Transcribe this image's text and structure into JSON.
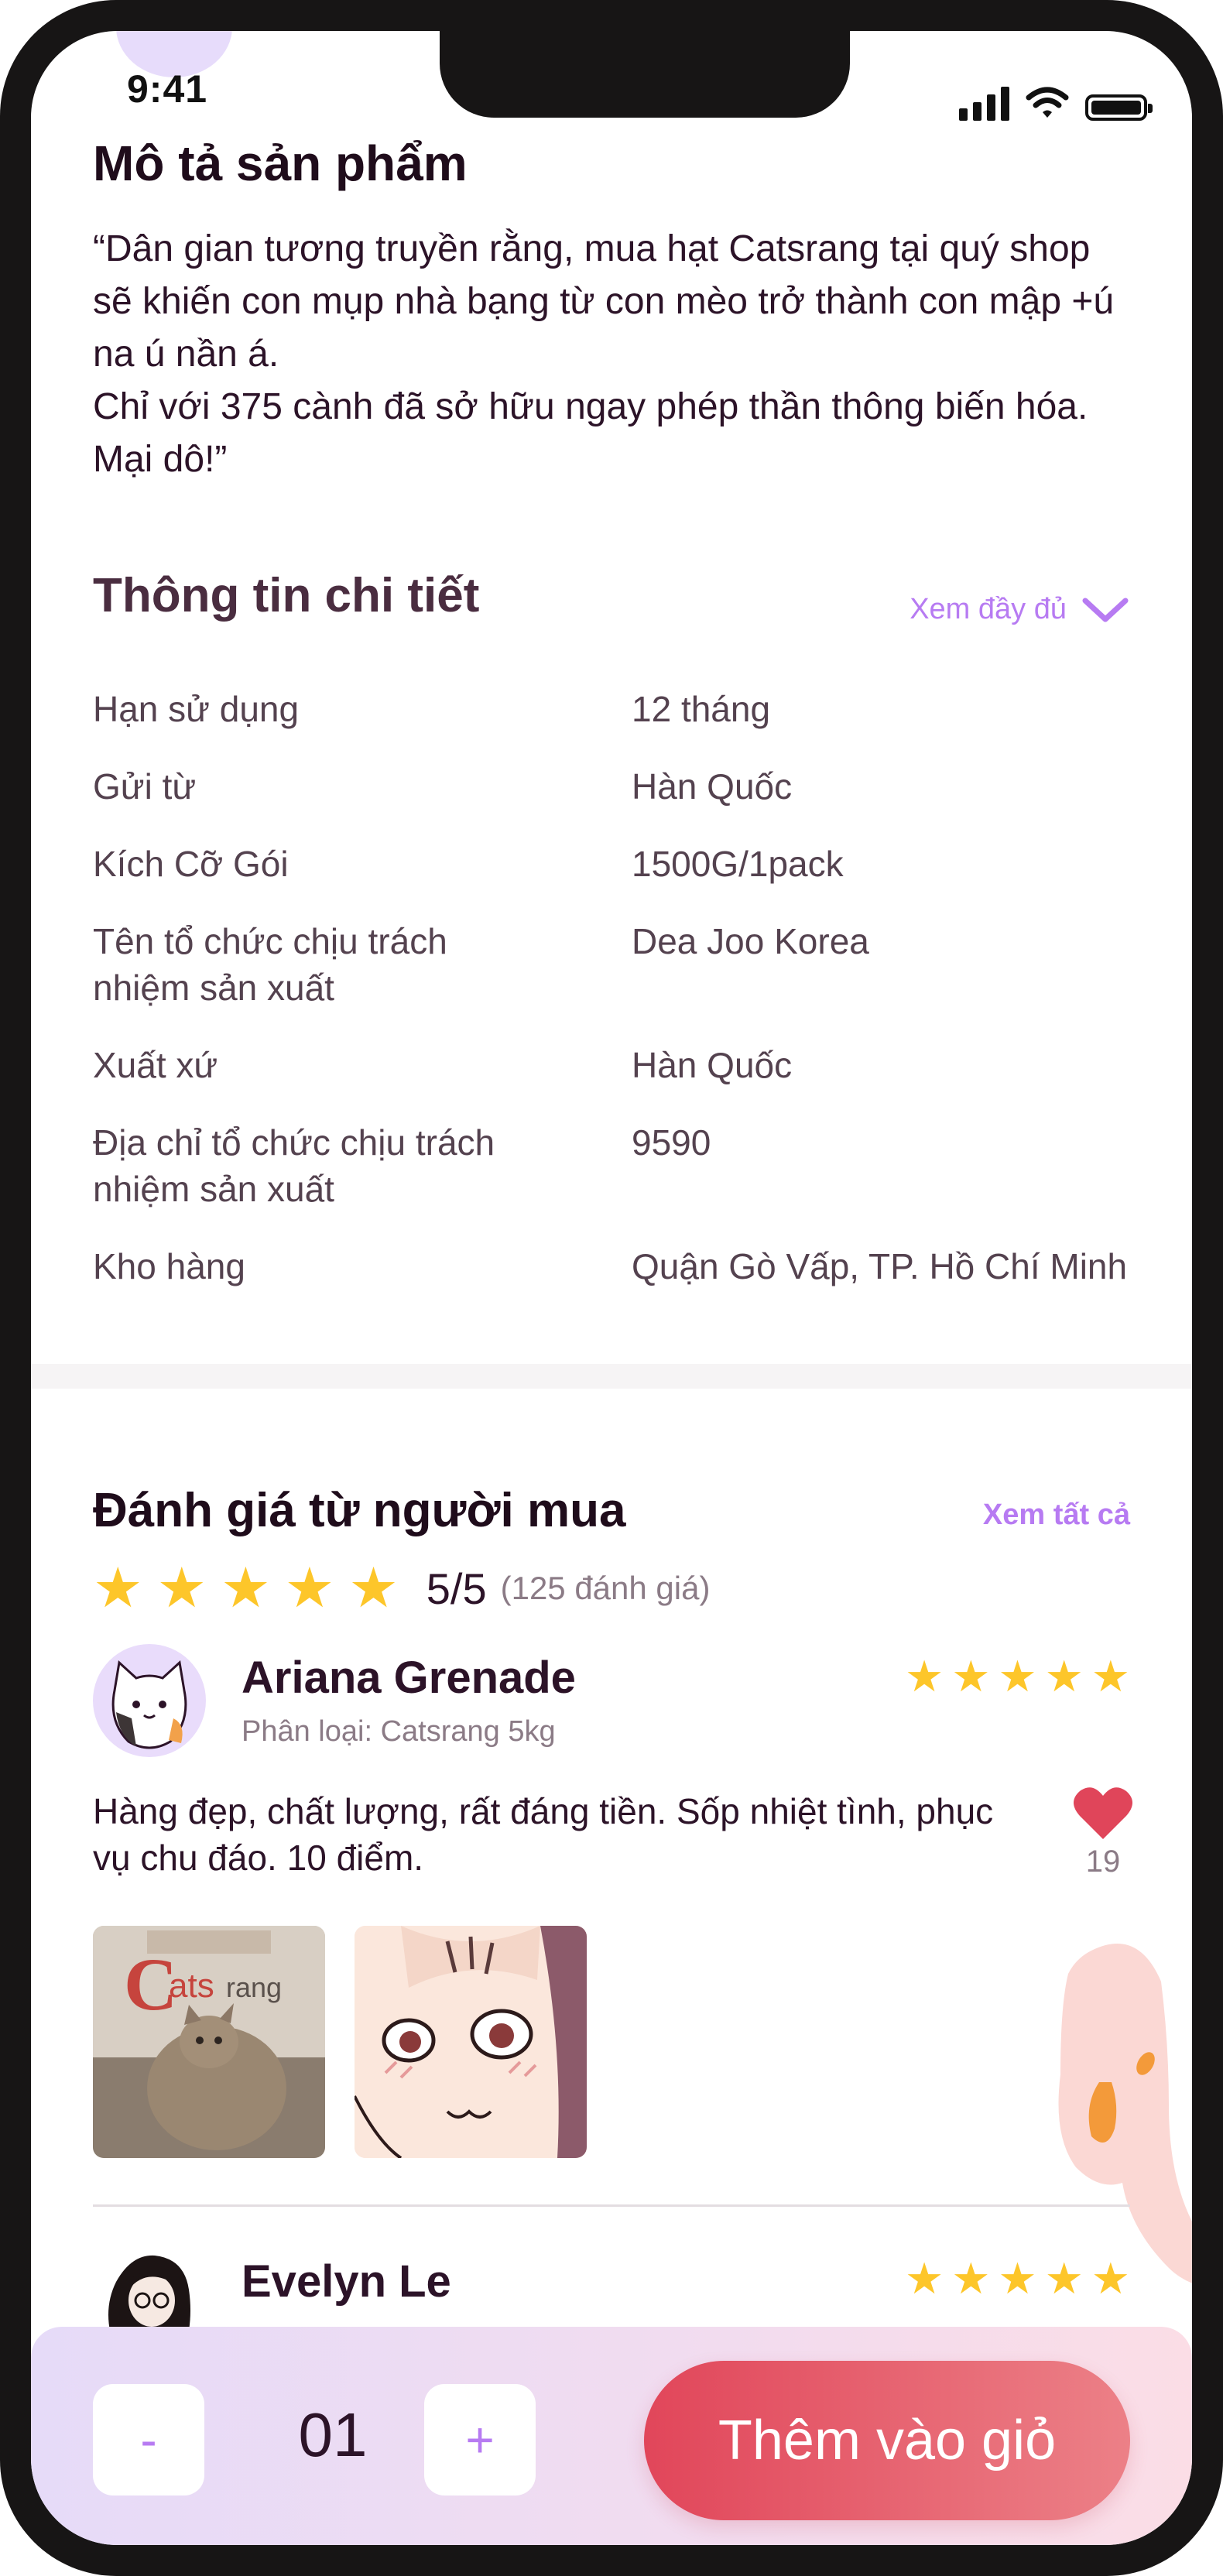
{
  "status_bar": {
    "time": "9:41"
  },
  "description": {
    "title": "Mô tả sản phẩm",
    "lines": [
      "“Dân gian tương truyền rằng, mua hạt Catsrang tại quý shop sẽ khiến con mụp nhà bạng từ con mèo trở thành con mập +ú na ú nần á.",
      "Chỉ với 375 cành đã sở hữu ngay phép thần thông biến hóa. Mại dô!”"
    ]
  },
  "details": {
    "title": "Thông tin chi tiết",
    "see_full_label": "Xem đầy đủ",
    "rows": [
      {
        "key": "Hạn sử dụng",
        "value": "12 tháng"
      },
      {
        "key": "Gửi từ",
        "value": "Hàn Quốc"
      },
      {
        "key": "Kích Cỡ Gói",
        "value": "1500G/1pack"
      },
      {
        "key": "Tên tổ chức chịu trách nhiệm sản xuất",
        "value": "Dea Joo Korea"
      },
      {
        "key": "Xuất xứ",
        "value": "Hàn Quốc"
      },
      {
        "key": "Địa chỉ tổ chức chịu trách nhiệm sản xuất",
        "value": "9590"
      },
      {
        "key": "Kho hàng",
        "value": "Quận Gò Vấp, TP. Hồ Chí Minh"
      }
    ]
  },
  "reviews": {
    "title": "Đánh giá từ người mua",
    "see_all_label": "Xem tất cả",
    "rating": "5/5",
    "rating_stars": 5,
    "count_label": "(125 đánh giá)",
    "items": [
      {
        "name": "Ariana Grenade",
        "variant": "Phân loại: Catsrang 5kg",
        "stars": 5,
        "text": "Hàng đẹp, chất lượng, rất đáng tiền. Sốp nhiệt tình, phục vụ chu đáo. 10 điểm.",
        "likes": "19",
        "photo_brand": "Catsrang"
      },
      {
        "name": "Evelyn Le",
        "stars": 5
      }
    ]
  },
  "cart_bar": {
    "minus_label": "-",
    "quantity": "01",
    "plus_label": "+",
    "add_label": "Thêm vào giỏ"
  },
  "colors": {
    "accent": "#b77bf2",
    "star": "#fdc62a",
    "heart": "#e0455a",
    "button": "#e1465a",
    "text": "#2c1328"
  },
  "icons": [
    "chevron-down-icon",
    "star-icon",
    "heart-icon",
    "signal-icon",
    "wifi-icon",
    "battery-icon"
  ]
}
